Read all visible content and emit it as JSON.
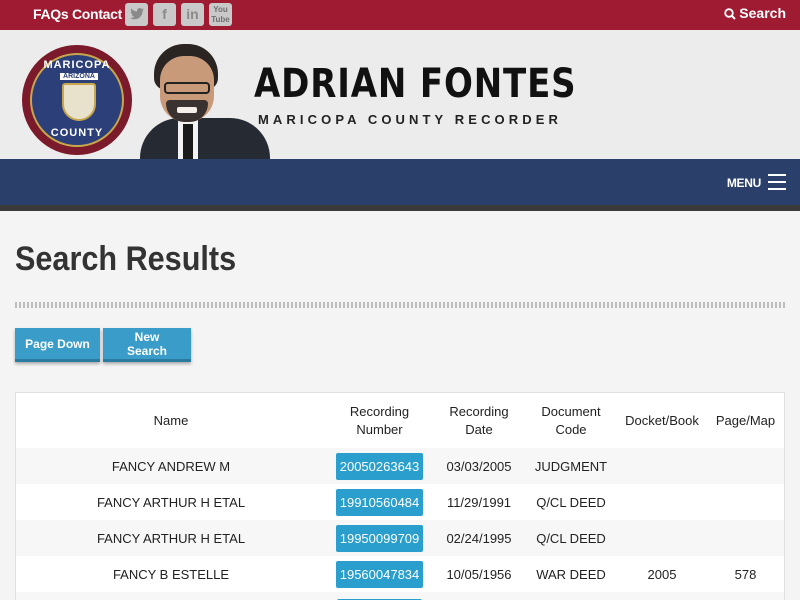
{
  "topbar": {
    "faqs": "FAQs",
    "contact": "Contact",
    "social": [
      {
        "icon": "twitter-icon",
        "glyph": "🐦"
      },
      {
        "icon": "facebook-icon",
        "glyph": "f"
      },
      {
        "icon": "linkedin-icon",
        "glyph": "in"
      },
      {
        "icon": "youtube-icon",
        "glyph": "You\nTube"
      }
    ],
    "search": "Search"
  },
  "header": {
    "seal_top": "MARICOPA",
    "seal_mid": "ARIZONA",
    "seal_bottom": "COUNTY",
    "name": "ADRIAN FONTES",
    "title": "MARICOPA COUNTY RECORDER"
  },
  "nav": {
    "menu": "MENU"
  },
  "page": {
    "title": "Search Results",
    "page_down": "Page Down",
    "new_search": "New Search"
  },
  "table": {
    "headers": {
      "name": "Name",
      "recording_number": "Recording\nNumber",
      "recording_date": "Recording\nDate",
      "document_code": "Document\nCode",
      "docket_book": "Docket/Book",
      "page_map": "Page/Map"
    },
    "rows": [
      {
        "name": "FANCY ANDREW M",
        "recording_number": "20050263643",
        "recording_date": "03/03/2005",
        "document_code": "JUDGMENT",
        "docket_book": "",
        "page_map": ""
      },
      {
        "name": "FANCY ARTHUR H ETAL",
        "recording_number": "19910560484",
        "recording_date": "11/29/1991",
        "document_code": "Q/CL DEED",
        "docket_book": "",
        "page_map": ""
      },
      {
        "name": "FANCY ARTHUR H ETAL",
        "recording_number": "19950099709",
        "recording_date": "02/24/1995",
        "document_code": "Q/CL DEED",
        "docket_book": "",
        "page_map": ""
      },
      {
        "name": "FANCY B ESTELLE",
        "recording_number": "19560047834",
        "recording_date": "10/05/1956",
        "document_code": "WAR DEED",
        "docket_book": "2005",
        "page_map": "578"
      }
    ]
  },
  "colors": {
    "topbar": "#9e1b32",
    "navbar": "#2a3f6a",
    "button": "#3a9cc8",
    "record_link": "#2a9fcd"
  }
}
